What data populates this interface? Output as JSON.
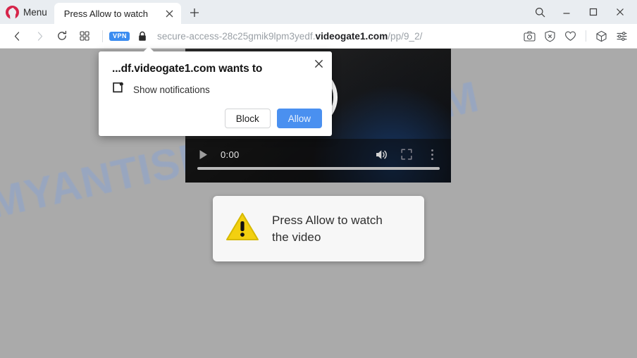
{
  "browser": {
    "name": "Opera",
    "menu_label": "Menu",
    "logo_icon": "opera-logo-icon",
    "tabs": [
      {
        "title": "Press Allow to watch",
        "close_icon": "close-icon",
        "active": true
      }
    ],
    "new_tab_icon": "plus-icon",
    "window_controls": [
      {
        "name": "search-tabs-button",
        "icon": "search-icon"
      },
      {
        "name": "minimize-button",
        "icon": "minimize-icon"
      },
      {
        "name": "maximize-button",
        "icon": "maximize-icon"
      },
      {
        "name": "close-window-button",
        "icon": "close-icon"
      }
    ]
  },
  "addressbar": {
    "back_icon": "chevron-left-icon",
    "forward_icon": "chevron-right-icon",
    "reload_icon": "reload-icon",
    "tiles_icon": "grid-icon",
    "vpn_badge": "VPN",
    "lock_icon": "lock-icon",
    "url_prefix": "secure-access-28c25gmik9lpm3yedf.",
    "url_host": "videogate1.com",
    "url_path": "/pp/9_2/",
    "full_url": "secure-access-28c25gmik9lpm3yedf.videogate1.com/pp/9_2/",
    "tools": [
      {
        "name": "snapshot-button",
        "icon": "camera-icon"
      },
      {
        "name": "ad-blocker-button",
        "icon": "shield-x-icon"
      },
      {
        "name": "favorites-button",
        "icon": "heart-icon"
      },
      {
        "name": "player-button",
        "icon": "cube-icon"
      },
      {
        "name": "easy-setup-button",
        "icon": "sliders-icon"
      }
    ]
  },
  "permission_popup": {
    "title": "...df.videogate1.com wants to",
    "permission_icon": "notification-icon",
    "permission_label": "Show notifications",
    "close_icon": "close-icon",
    "block_label": "Block",
    "allow_label": "Allow",
    "allow_color": "#4a90f0"
  },
  "page": {
    "background_color": "#aaaaaa",
    "watermark_text": "MYANTISPYWARE.COM",
    "watermark_color": "#8ea4cd",
    "video_player": {
      "play_icon": "play-icon",
      "time": "0:00",
      "volume_icon": "volume-icon",
      "fullscreen_icon": "fullscreen-icon",
      "more_icon": "more-vertical-icon",
      "spinner_icon": "loading-spinner-icon"
    },
    "warning_box": {
      "icon": "warning-triangle-icon",
      "line1": "Press Allow to watch",
      "line2": "the video",
      "icon_color": "#f3d010"
    }
  }
}
